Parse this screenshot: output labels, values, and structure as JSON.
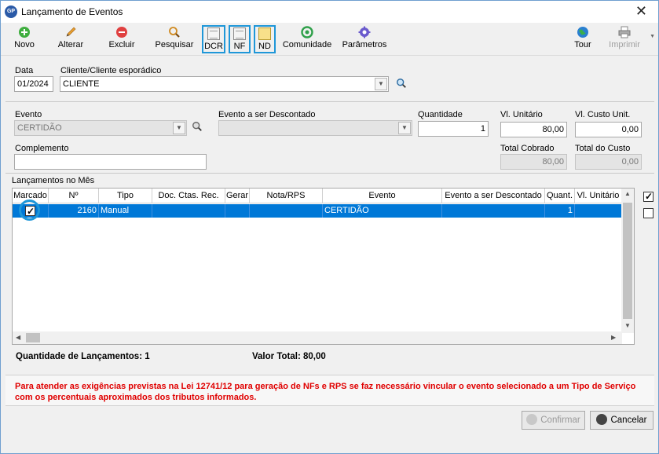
{
  "window": {
    "title": "Lançamento de Eventos",
    "app_badge": "GP"
  },
  "toolbar": {
    "novo": "Novo",
    "alterar": "Alterar",
    "excluir": "Excluir",
    "pesquisar": "Pesquisar",
    "dcr": "DCR",
    "nf": "NF",
    "nd": "ND",
    "comunidade": "Comunidade",
    "parametros": "Parâmetros",
    "tour": "Tour",
    "imprimir": "Imprimir"
  },
  "header_form": {
    "data_label": "Data",
    "data_value": "01/2024",
    "cliente_label": "Cliente/Cliente esporádico",
    "cliente_value": "CLIENTE"
  },
  "event_form": {
    "evento_label": "Evento",
    "evento_value": "CERTIDÃO",
    "desconto_label": "Evento a ser Descontado",
    "desconto_value": "",
    "quantidade_label": "Quantidade",
    "quantidade_value": "1",
    "vl_unitario_label": "Vl. Unitário",
    "vl_unitario_value": "80,00",
    "vl_custo_label": "Vl. Custo Unit.",
    "vl_custo_value": "0,00",
    "complemento_label": "Complemento",
    "complemento_value": "",
    "total_cobrado_label": "Total Cobrado",
    "total_cobrado_value": "80,00",
    "total_custo_label": "Total do Custo",
    "total_custo_value": "0,00"
  },
  "grid": {
    "section_label": "Lançamentos no Mês",
    "columns": [
      "Marcado",
      "Nº",
      "Tipo",
      "Doc. Ctas. Rec.",
      "Gerar",
      "Nota/RPS",
      "Evento",
      "Evento a ser Descontado",
      "Quant.",
      "Vl. Unitário"
    ],
    "rows": [
      {
        "marcado": true,
        "numero": "2160",
        "tipo": "Manual",
        "doc": "",
        "gerar": "",
        "nota": "",
        "evento": "CERTIDÃO",
        "desconto": "",
        "quant": "1",
        "vl_unitario": ""
      }
    ]
  },
  "summary": {
    "qtd_label": "Quantidade de Lançamentos:",
    "qtd_value": "1",
    "total_label": "Valor Total:",
    "total_value": "80,00"
  },
  "notice": "Para atender as exigências previstas na Lei 12741/12 para geração de NFs e RPS se faz necessário vincular o evento selecionado a um Tipo de Serviço com os percentuais aproximados dos tributos informados.",
  "footer": {
    "confirmar": "Confirmar",
    "cancelar": "Cancelar"
  },
  "colors": {
    "selection": "#0078d7",
    "highlight": "#1f97d8",
    "notice_text": "#e00000"
  }
}
